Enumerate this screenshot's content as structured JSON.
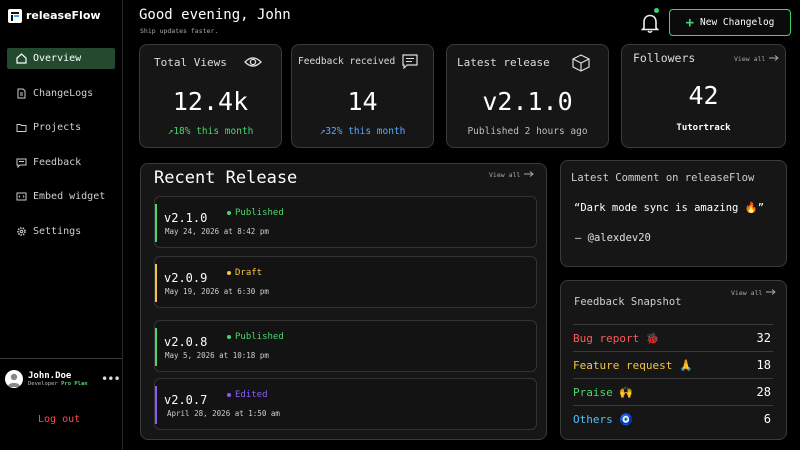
{
  "app": {
    "name": "releaseFlow"
  },
  "sidebar": {
    "items": [
      {
        "label": "Overview",
        "icon": "home-icon",
        "active": true
      },
      {
        "label": "ChangeLogs",
        "icon": "document-icon"
      },
      {
        "label": "Projects",
        "icon": "folder-icon"
      },
      {
        "label": "Feedback",
        "icon": "chat-icon"
      },
      {
        "label": "Embed widget",
        "icon": "code-icon"
      },
      {
        "label": "Settings",
        "icon": "gear-icon"
      }
    ],
    "user": {
      "name": "John.Doe",
      "role": "Developer",
      "plan": "Pro Plan"
    },
    "logout_label": "Log out"
  },
  "header": {
    "greeting": "Good evening, John",
    "tagline": "Ship updates faster.",
    "new_button": "New Changelog"
  },
  "stats": {
    "views": {
      "title": "Total Views",
      "value": "12.4k",
      "sub": "↗18% this month"
    },
    "feedback": {
      "title": "Feedback received",
      "value": "14",
      "sub": "↗32% this month"
    },
    "release": {
      "title": "Latest release",
      "value": "v2.1.0",
      "sub": "Published 2 hours ago"
    },
    "followers": {
      "title": "Followers",
      "value": "42",
      "sub": "Tutortrack",
      "view_all": "View all"
    }
  },
  "recent_release": {
    "title": "Recent Release",
    "view_all": "View all",
    "items": [
      {
        "version": "v2.1.0",
        "status": "Published",
        "date": "May 24, 2026 at 8:42 pm",
        "color": "#4ad66d"
      },
      {
        "version": "v2.0.9",
        "status": "Draft",
        "date": "May 19, 2026 at 6:30 pm",
        "color": "#f5c542"
      },
      {
        "version": "v2.0.8",
        "status": "Published",
        "date": "May 5, 2026 at 10:18 pm",
        "color": "#4ad66d"
      },
      {
        "version": "v2.0.7",
        "status": "Edited",
        "date": "April 28, 2026 at 1:50 am",
        "color": "#8b5cf6"
      }
    ]
  },
  "latest_comment": {
    "title": "Latest Comment on releaseFlow",
    "quote": "“Dark mode sync is amazing 🔥”",
    "author": "– @alexdev20"
  },
  "feedback_snapshot": {
    "title": "Feedback Snapshot",
    "view_all": "View all",
    "rows": [
      {
        "label": "Bug report 🐞",
        "count": "32",
        "color": "#ff5a5a"
      },
      {
        "label": "Feature request 🙏",
        "count": "18",
        "color": "#f5c542"
      },
      {
        "label": "Praise 🙌",
        "count": "28",
        "color": "#4ad66d"
      },
      {
        "label": "Others 🧿",
        "count": "6",
        "color": "#4fc3f7"
      }
    ]
  },
  "colors": {
    "accent": "#3ed46a",
    "card": "#161616",
    "border": "#3a3a3a",
    "danger": "#ff4b4b"
  }
}
